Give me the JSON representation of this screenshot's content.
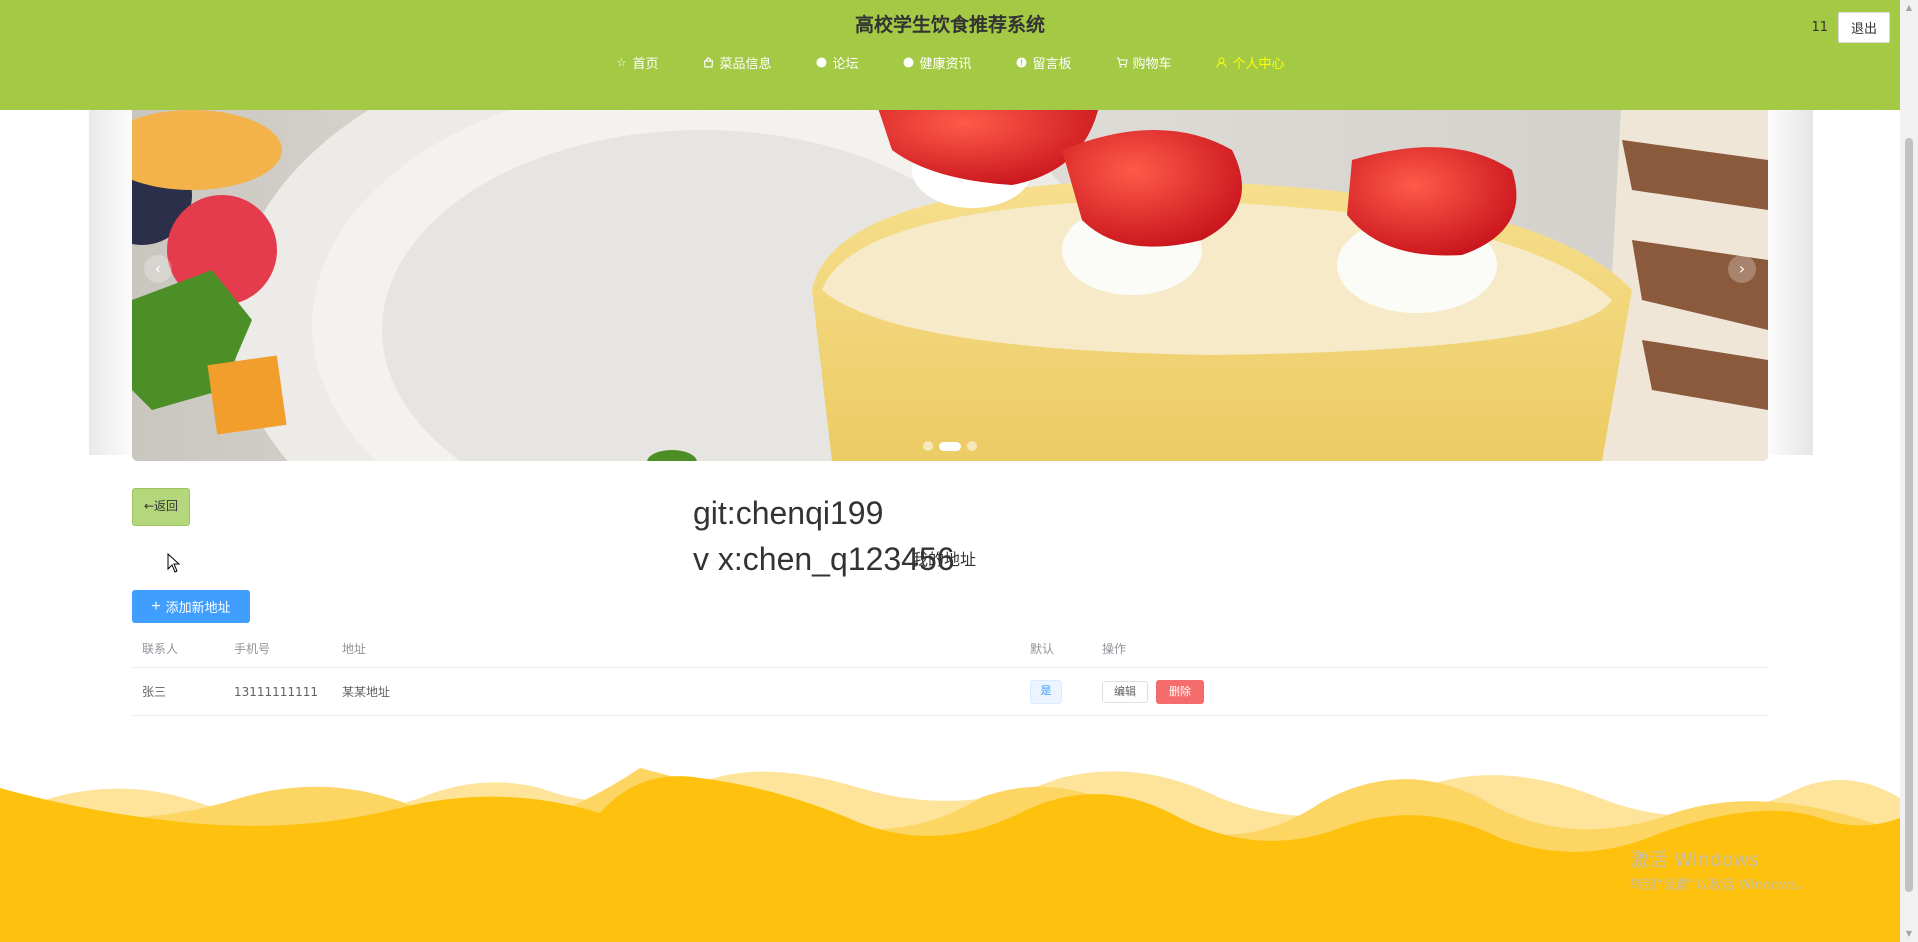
{
  "header": {
    "title": "高校学生饮食推荐系统",
    "nav": [
      {
        "label": "首页",
        "icon": "star-icon"
      },
      {
        "label": "菜品信息",
        "icon": "bag-icon"
      },
      {
        "label": "论坛",
        "icon": "info-icon"
      },
      {
        "label": "健康资讯",
        "icon": "info-icon"
      },
      {
        "label": "留言板",
        "icon": "info-icon"
      },
      {
        "label": "购物车",
        "icon": "cart-icon"
      },
      {
        "label": "个人中心",
        "icon": "user-icon",
        "active": true
      }
    ],
    "user_id": "11",
    "logout_label": "退出",
    "colors": {
      "bar": "#a3c945",
      "active_nav": "#ffff00"
    }
  },
  "carousel": {
    "prev_glyph": "‹",
    "next_glyph": "›",
    "slide_count": 3,
    "active_slide": 2
  },
  "main": {
    "back_label": "←返回",
    "heading": "我的地址",
    "watermark_line1": "git:chenqi199",
    "watermark_line2": "v x:chen_q123456",
    "add_label": "添加新地址",
    "add_icon": "plus-icon"
  },
  "table": {
    "columns": [
      "联系人",
      "手机号",
      "地址",
      "默认",
      "操作"
    ],
    "rows": [
      {
        "contact": "张三",
        "phone": "13111111111",
        "address": "某某地址",
        "is_default": "是",
        "edit_label": "编辑",
        "delete_label": "删除"
      }
    ]
  },
  "windows_activation": {
    "line1": "激活 Windows",
    "line2": "转到“设置”以激活 Windows。"
  },
  "colors": {
    "primary": "#409eff",
    "danger": "#f56c6c",
    "footer": "#fdc10e"
  }
}
